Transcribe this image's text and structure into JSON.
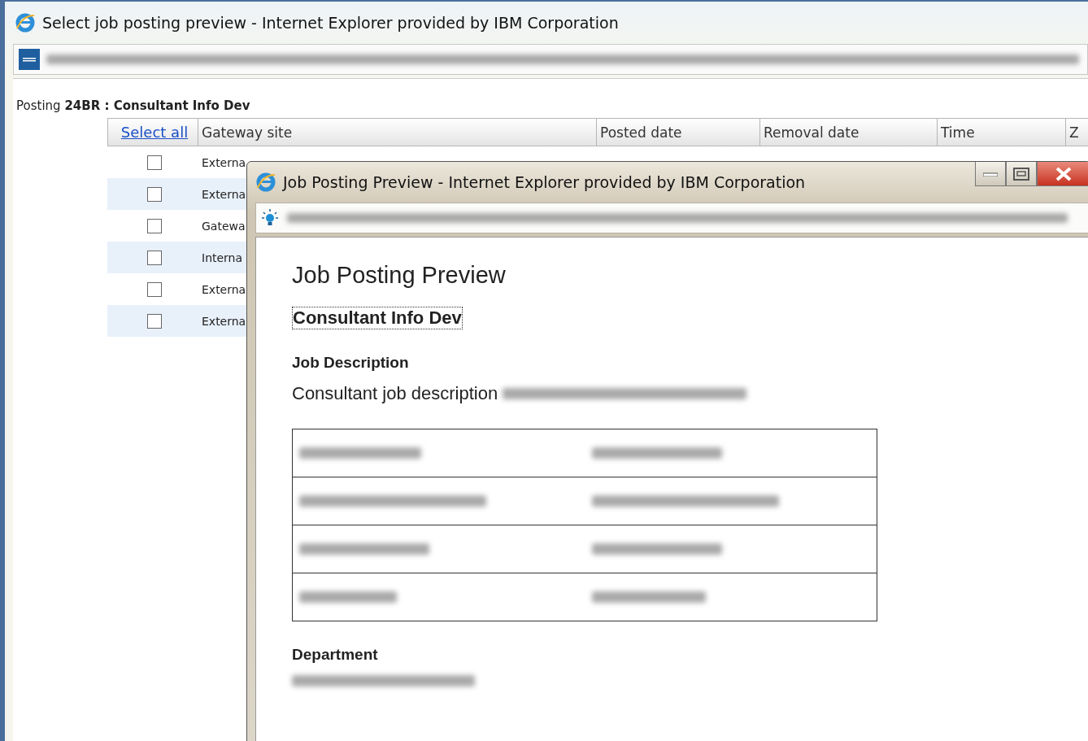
{
  "back_window": {
    "title": "Select job posting preview - Internet Explorer provided by IBM Corporation",
    "posting": {
      "prefix": "Posting",
      "id": "24BR : Consultant Info Dev"
    },
    "table": {
      "select_all": "Select all",
      "columns": [
        "Gateway site",
        "Posted date",
        "Removal date",
        "Time",
        "Z"
      ],
      "rows": [
        {
          "site": "Externa",
          "checked": false
        },
        {
          "site": "Externa",
          "checked": false
        },
        {
          "site": "Gatewa",
          "checked": false
        },
        {
          "site": "Interna",
          "checked": false
        },
        {
          "site": "Externa",
          "checked": false
        },
        {
          "site": "Externa",
          "checked": false
        }
      ]
    }
  },
  "preview_window": {
    "title": "Job Posting Preview - Internet Explorer provided by IBM Corporation",
    "heading": "Job Posting Preview",
    "job_title": "Consultant Info Dev",
    "sections": [
      {
        "kind": "description",
        "label": "Job Description",
        "text": "Consultant job description"
      },
      {
        "kind": "department",
        "label": "Department"
      }
    ]
  }
}
